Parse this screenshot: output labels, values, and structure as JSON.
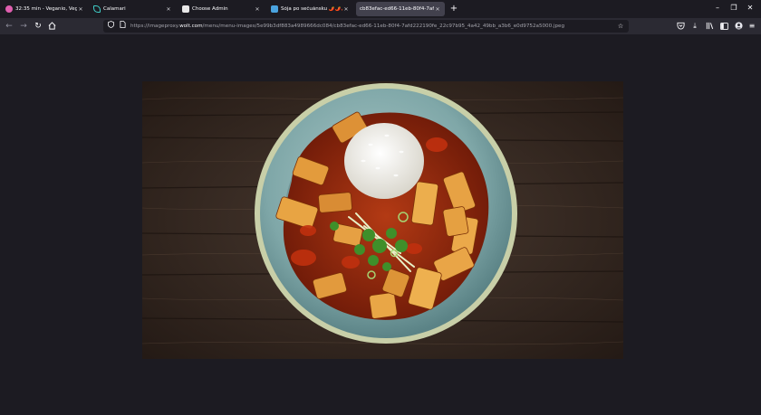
{
  "tabs": [
    {
      "label": "32:35 min - Veganio, Veganio -",
      "favicon_color": "#e05fb0",
      "active": false
    },
    {
      "label": "Calamari",
      "favicon_color": "#3fd0c9",
      "active": false
    },
    {
      "label": "Choose Admin",
      "favicon_color": "#e8e8e8",
      "active": false
    },
    {
      "label": "Sója po sečuánsku 🌶️🌶️🌶️ (1.",
      "favicon_color": "#4aa3df",
      "active": false
    },
    {
      "label": "cb83efac-ed66-11eb-80f4-7afd22",
      "favicon_color": "#42414d",
      "active": true
    }
  ],
  "new_tab_label": "+",
  "window_controls": {
    "minimize": "–",
    "restore": "❐",
    "close": "✕"
  },
  "nav": {
    "back_icon": "arrow-left-icon",
    "forward_icon": "arrow-right-icon",
    "reload_icon": "reload-icon",
    "home_icon": "home-icon"
  },
  "address_bar": {
    "url_prefix": "https://imageproxy.",
    "url_domain": "wolt.com",
    "url_suffix": "/menu/menu-images/5e99b3df883a4989666dc084/cb83efac-ed66-11eb-80f4-7afd222190fe_22c97b95_4a42_49bb_a3b6_e0d9752a5000.jpeg",
    "shield_icon": "tracking-protection-icon",
    "page_icon": "page-info-icon",
    "bookmark_icon": "bookmark-star-icon"
  },
  "toolbar_icons": [
    "pocket-icon",
    "downloads-icon",
    "library-icon",
    "sidebar-icon",
    "account-icon",
    "menu-icon"
  ],
  "image": {
    "subject": "sichuan-tofu-with-rice",
    "background_color": "#1c1b22"
  },
  "colors": {
    "tab_bar": "#1c1b22",
    "toolbar": "#2b2a33",
    "active_tab": "#42414d",
    "accent": "#fbfbfe"
  }
}
